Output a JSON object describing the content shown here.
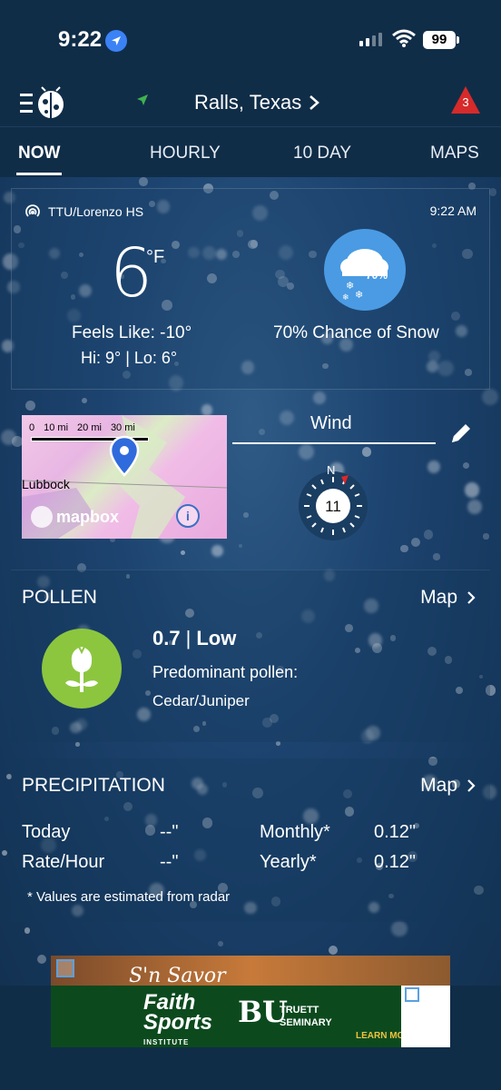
{
  "status_bar": {
    "time": "9:22",
    "battery": "99"
  },
  "header": {
    "location": "Ralls,  Texas",
    "alert_count": "3"
  },
  "tabs": [
    {
      "label": "NOW",
      "active": true
    },
    {
      "label": "HOURLY",
      "active": false
    },
    {
      "label": "10 DAY",
      "active": false
    },
    {
      "label": "MAPS",
      "active": false
    }
  ],
  "current": {
    "station": "TTU/Lorenzo HS",
    "obs_time": "9:22 AM",
    "temperature": "6",
    "unit": "°F",
    "feels_like": "Feels Like: -10°",
    "hi_lo": "Hi: 9° | Lo: 6°",
    "icon": "snow-cloud-icon",
    "icon_pct": "70%",
    "condition": "70% Chance of Snow"
  },
  "map": {
    "scale_labels": [
      "0",
      "10 mi",
      "20 mi",
      "30 mi"
    ],
    "city": "Lubbock",
    "provider": "mapbox",
    "info": "i"
  },
  "wind": {
    "label": "Wind",
    "speed": "11",
    "direction_label": "N"
  },
  "pollen": {
    "title": "POLLEN",
    "link": "Map",
    "value": "0.7",
    "level": "Low",
    "predominant_label": "Predominant pollen:",
    "type": "Cedar/Juniper",
    "color": "#8cc63f"
  },
  "precip": {
    "title": "PRECIPITATION",
    "link": "Map",
    "rows": [
      {
        "label": "Today",
        "value": "--\"",
        "label2": "Monthly*",
        "value2": "0.12\""
      },
      {
        "label": "Rate/Hour",
        "value": "--\"",
        "label2": "Yearly*",
        "value2": "0.12\""
      }
    ],
    "note": "* Values are estimated from radar"
  },
  "ad": {
    "strip_text": "S'n Savor",
    "faith_line1": "Faith",
    "faith_line2": "Sports",
    "faith_sub": "INSTITUTE",
    "bu": "BU",
    "truett_line1": "TRUETT",
    "truett_line2": "SEMINARY",
    "learn_more": "LEARN MORE"
  }
}
